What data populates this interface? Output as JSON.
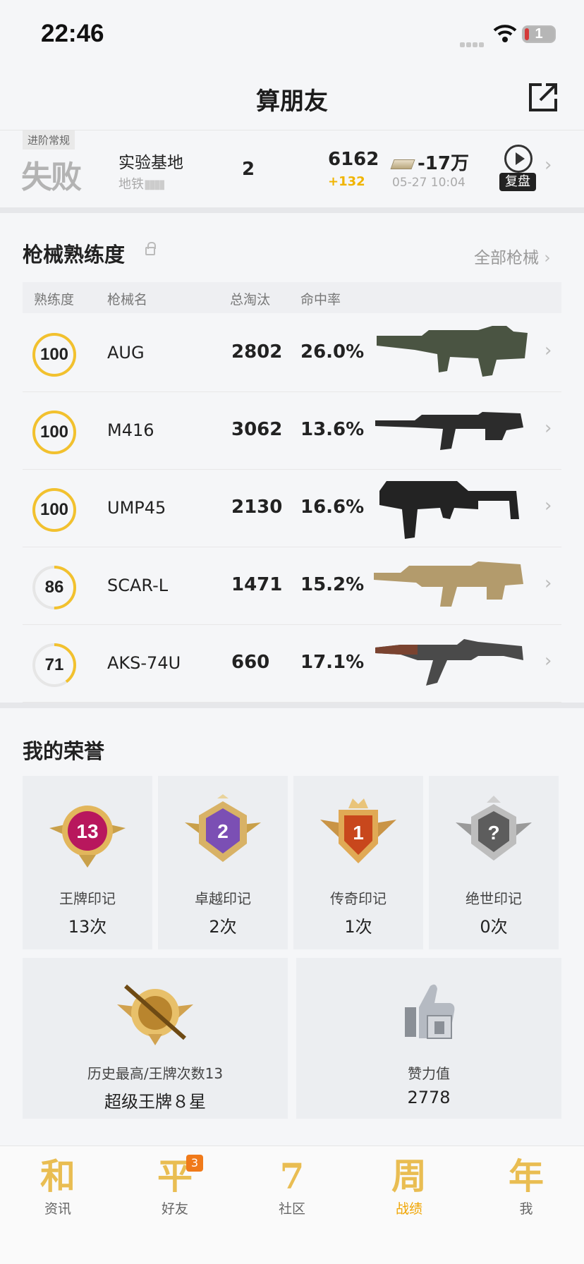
{
  "status": {
    "time": "22:46",
    "battery": "1"
  },
  "header": {
    "title": "算朋友"
  },
  "match": {
    "mode": "进阶常规",
    "result": "失败",
    "map": "实验基地",
    "sub": "地铁",
    "rank": "2",
    "score": "6162",
    "delta": "+132",
    "money": "-17万",
    "date": "05-27 10:04",
    "replay": "复盘"
  },
  "weapons": {
    "title": "枪械熟练度",
    "all_label": "全部枪械",
    "headers": [
      "熟练度",
      "枪械名",
      "总淘汰",
      "命中率"
    ],
    "rows": [
      {
        "level": "100",
        "progress": 1.0,
        "name": "AUG",
        "kills": "2802",
        "acc": "26.0%"
      },
      {
        "level": "100",
        "progress": 1.0,
        "name": "M416",
        "kills": "3062",
        "acc": "13.6%"
      },
      {
        "level": "100",
        "progress": 1.0,
        "name": "UMP45",
        "kills": "2130",
        "acc": "16.6%"
      },
      {
        "level": "86",
        "progress": 0.5,
        "name": "SCAR-L",
        "kills": "1471",
        "acc": "15.2%"
      },
      {
        "level": "71",
        "progress": 0.4,
        "name": "AKS-74U",
        "kills": "660",
        "acc": "17.1%"
      }
    ]
  },
  "honor": {
    "title": "我的荣誉",
    "cards": [
      {
        "name": "王牌印记",
        "value": "13次",
        "badge_text": "13"
      },
      {
        "name": "卓越印记",
        "value": "2次",
        "badge_text": "2"
      },
      {
        "name": "传奇印记",
        "value": "1次",
        "badge_text": "1"
      },
      {
        "name": "绝世印记",
        "value": "0次",
        "badge_text": "?"
      }
    ],
    "highest": {
      "label": "历史最高/王牌次数13",
      "value": "超级王牌８星"
    },
    "likes": {
      "label": "赞力值",
      "value": "2778"
    }
  },
  "tabs": [
    {
      "icon": "和",
      "label": "资讯"
    },
    {
      "icon": "平",
      "label": "好友",
      "badge": "3"
    },
    {
      "icon": "7",
      "label": "社区"
    },
    {
      "icon": "周",
      "label": "战绩"
    },
    {
      "icon": "年",
      "label": "我"
    }
  ],
  "colors": {
    "accent": "#f0b400",
    "ring": "#f2c12e"
  }
}
